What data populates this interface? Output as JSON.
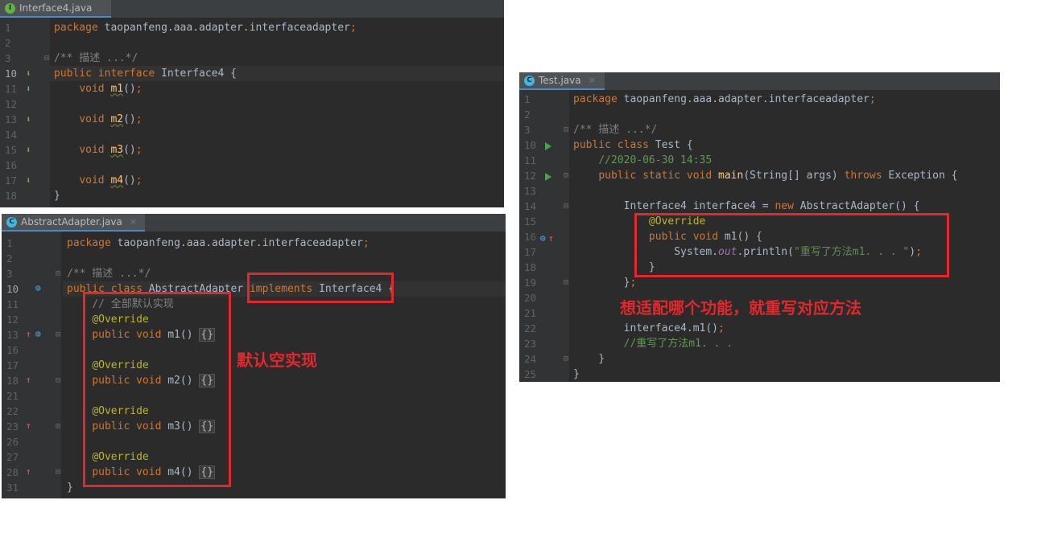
{
  "interface_panel": {
    "tab": {
      "icon": "I",
      "label": "Interface4.java",
      "close": "×"
    },
    "lines": [
      {
        "n": "1",
        "code": [
          [
            "kw",
            "package "
          ],
          [
            "",
            "taopanfeng.aaa.adapter.interfaceadapter"
          ],
          [
            "kw",
            ";"
          ]
        ]
      },
      {
        "n": "2",
        "code": []
      },
      {
        "n": "3",
        "code": [
          [
            "cm2",
            "/** 描述 ...*/"
          ]
        ]
      },
      {
        "n": "10",
        "code": [
          [
            "kw",
            "public interface "
          ],
          [
            "",
            "Interface4 {"
          ]
        ],
        "current": true
      },
      {
        "n": "11",
        "code": [
          [
            "",
            "    "
          ],
          [
            "kw",
            "void "
          ],
          [
            "fnu",
            "m1"
          ],
          [
            "",
            "()"
          ],
          [
            "kw",
            ";"
          ]
        ]
      },
      {
        "n": "12",
        "code": []
      },
      {
        "n": "13",
        "code": [
          [
            "",
            "    "
          ],
          [
            "kw",
            "void "
          ],
          [
            "fnu",
            "m2"
          ],
          [
            "",
            "()"
          ],
          [
            "kw",
            ";"
          ]
        ]
      },
      {
        "n": "14",
        "code": []
      },
      {
        "n": "15",
        "code": [
          [
            "",
            "    "
          ],
          [
            "kw",
            "void "
          ],
          [
            "fnu",
            "m3"
          ],
          [
            "",
            "()"
          ],
          [
            "kw",
            ";"
          ]
        ]
      },
      {
        "n": "16",
        "code": []
      },
      {
        "n": "17",
        "code": [
          [
            "",
            "    "
          ],
          [
            "kw",
            "void "
          ],
          [
            "fnu",
            "m4"
          ],
          [
            "",
            "()"
          ],
          [
            "kw",
            ";"
          ]
        ]
      },
      {
        "n": "18",
        "code": [
          [
            "",
            "}"
          ]
        ]
      }
    ]
  },
  "abstract_panel": {
    "tab": {
      "icon": "C",
      "label": "AbstractAdapter.java",
      "close": "×"
    },
    "lines": [
      {
        "n": "1",
        "code": [
          [
            "kw",
            "package "
          ],
          [
            "",
            "taopanfeng.aaa.adapter.interfaceadapter"
          ],
          [
            "kw",
            ";"
          ]
        ]
      },
      {
        "n": "2",
        "code": []
      },
      {
        "n": "3",
        "code": [
          [
            "cm2",
            "/** 描述 ...*/"
          ]
        ]
      },
      {
        "n": "10",
        "code": [
          [
            "kw",
            "public class "
          ],
          [
            "",
            "AbstractAdapter "
          ],
          [
            "kw",
            "implements "
          ],
          [
            "",
            "Interface4 {"
          ]
        ],
        "current": true
      },
      {
        "n": "11",
        "code": [
          [
            "",
            "    "
          ],
          [
            "cm2",
            "// 全部默认实现"
          ]
        ]
      },
      {
        "n": "12",
        "code": [
          [
            "",
            "    "
          ],
          [
            "ann",
            "@Override"
          ]
        ]
      },
      {
        "n": "13",
        "code": [
          [
            "",
            "    "
          ],
          [
            "kw",
            "public void "
          ],
          [
            "",
            "m1() "
          ],
          [
            "br",
            "{}"
          ]
        ]
      },
      {
        "n": "16",
        "code": []
      },
      {
        "n": "17",
        "code": [
          [
            "",
            "    "
          ],
          [
            "ann",
            "@Override"
          ]
        ]
      },
      {
        "n": "18",
        "code": [
          [
            "",
            "    "
          ],
          [
            "kw",
            "public void "
          ],
          [
            "",
            "m2() "
          ],
          [
            "br",
            "{}"
          ]
        ]
      },
      {
        "n": "21",
        "code": []
      },
      {
        "n": "22",
        "code": [
          [
            "",
            "    "
          ],
          [
            "ann",
            "@Override"
          ]
        ]
      },
      {
        "n": "23",
        "code": [
          [
            "",
            "    "
          ],
          [
            "kw",
            "public void "
          ],
          [
            "",
            "m3() "
          ],
          [
            "br",
            "{}"
          ]
        ]
      },
      {
        "n": "26",
        "code": []
      },
      {
        "n": "27",
        "code": [
          [
            "",
            "    "
          ],
          [
            "ann",
            "@Override"
          ]
        ]
      },
      {
        "n": "28",
        "code": [
          [
            "",
            "    "
          ],
          [
            "kw",
            "public void "
          ],
          [
            "",
            "m4() "
          ],
          [
            "br",
            "{}"
          ]
        ]
      },
      {
        "n": "31",
        "code": [
          [
            "",
            "}"
          ]
        ]
      }
    ],
    "annotation": "默认空实现"
  },
  "test_panel": {
    "tab": {
      "icon": "C",
      "label": "Test.java",
      "close": "×"
    },
    "lines": [
      {
        "n": "1",
        "code": [
          [
            "kw",
            "package "
          ],
          [
            "",
            "taopanfeng.aaa.adapter.interfaceadapter"
          ],
          [
            "kw",
            ";"
          ]
        ]
      },
      {
        "n": "2",
        "code": []
      },
      {
        "n": "3",
        "code": [
          [
            "cm2",
            "/** 描述 ...*/"
          ]
        ]
      },
      {
        "n": "10",
        "code": [
          [
            "kw",
            "public class "
          ],
          [
            "",
            "Test {"
          ]
        ]
      },
      {
        "n": "11",
        "code": [
          [
            "",
            "    "
          ],
          [
            "cm",
            "//2020-06-30 14:35"
          ]
        ]
      },
      {
        "n": "12",
        "code": [
          [
            "",
            "    "
          ],
          [
            "kw",
            "public static void "
          ],
          [
            "fn",
            "main"
          ],
          [
            "",
            "(String[] args) "
          ],
          [
            "kw",
            "throws "
          ],
          [
            "",
            "Exception {"
          ]
        ]
      },
      {
        "n": "13",
        "code": []
      },
      {
        "n": "14",
        "code": [
          [
            "",
            "        Interface4 interface4 = "
          ],
          [
            "kw",
            "new "
          ],
          [
            "",
            "AbstractAdapter() {"
          ]
        ]
      },
      {
        "n": "15",
        "code": [
          [
            "",
            "            "
          ],
          [
            "ann",
            "@Override"
          ]
        ]
      },
      {
        "n": "16",
        "code": [
          [
            "",
            "            "
          ],
          [
            "kw",
            "public void "
          ],
          [
            "",
            "m1() {"
          ]
        ]
      },
      {
        "n": "17",
        "code": [
          [
            "",
            "                System."
          ],
          [
            "fld",
            "out"
          ],
          [
            "",
            ".println("
          ],
          [
            "str",
            "\"重写了方法m1. . . \""
          ],
          [
            "",
            ")"
          ],
          [
            "kw",
            ";"
          ]
        ]
      },
      {
        "n": "18",
        "code": [
          [
            "",
            "            }"
          ]
        ]
      },
      {
        "n": "19",
        "code": [
          [
            "",
            "        }"
          ],
          [
            "kw",
            ";"
          ]
        ]
      },
      {
        "n": "20",
        "code": []
      },
      {
        "n": "21",
        "code": []
      },
      {
        "n": "22",
        "code": [
          [
            "",
            "        interface4.m1()"
          ],
          [
            "kw",
            ";"
          ]
        ]
      },
      {
        "n": "23",
        "code": [
          [
            "",
            "        "
          ],
          [
            "cm",
            "//重写了方法m1. . ."
          ]
        ]
      },
      {
        "n": "24",
        "code": [
          [
            "",
            "    }"
          ]
        ]
      },
      {
        "n": "25",
        "code": [
          [
            "",
            "}"
          ]
        ]
      }
    ],
    "annotation": "想适配哪个功能，就重写对应方法"
  },
  "colors": {
    "editor_bg": "#2b2b2b",
    "gutter_bg": "#313335",
    "keyword": "#cc7832",
    "annotation": "#bbb529",
    "comment": "#629755",
    "string": "#6a8759",
    "highlight_box": "#e0282d"
  }
}
